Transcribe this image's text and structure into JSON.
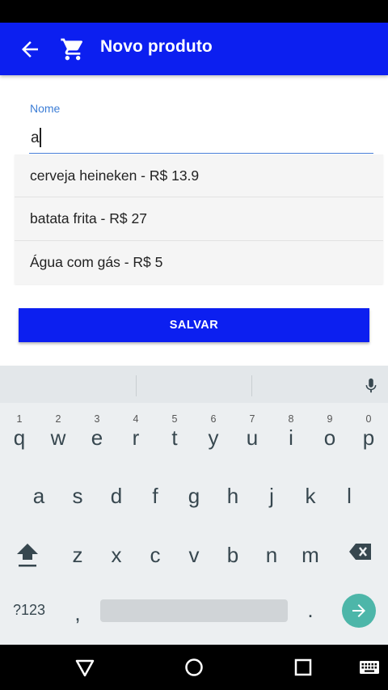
{
  "app_bar": {
    "title": "Novo produto",
    "color": "#0c1ff0",
    "icons": [
      "arrow-back-icon",
      "shopping-cart-icon"
    ]
  },
  "form": {
    "name_label": "Nome",
    "name_value": "a",
    "suggestions": [
      "cerveja heineken - R$ 13.9",
      "batata frita - R$ 27",
      "Água com gás - R$ 5"
    ],
    "save_label": "SALVAR"
  },
  "keyboard": {
    "row1": [
      {
        "hint": "1",
        "ch": "q"
      },
      {
        "hint": "2",
        "ch": "w"
      },
      {
        "hint": "3",
        "ch": "e"
      },
      {
        "hint": "4",
        "ch": "r"
      },
      {
        "hint": "5",
        "ch": "t"
      },
      {
        "hint": "6",
        "ch": "y"
      },
      {
        "hint": "7",
        "ch": "u"
      },
      {
        "hint": "8",
        "ch": "i"
      },
      {
        "hint": "9",
        "ch": "o"
      },
      {
        "hint": "0",
        "ch": "p"
      }
    ],
    "row2": [
      "a",
      "s",
      "d",
      "f",
      "g",
      "h",
      "j",
      "k",
      "l"
    ],
    "row3": [
      "z",
      "x",
      "c",
      "v",
      "b",
      "n",
      "m"
    ],
    "symbols_label": "?123",
    "comma": ",",
    "period": ".",
    "enter_color": "#4db6a9"
  }
}
